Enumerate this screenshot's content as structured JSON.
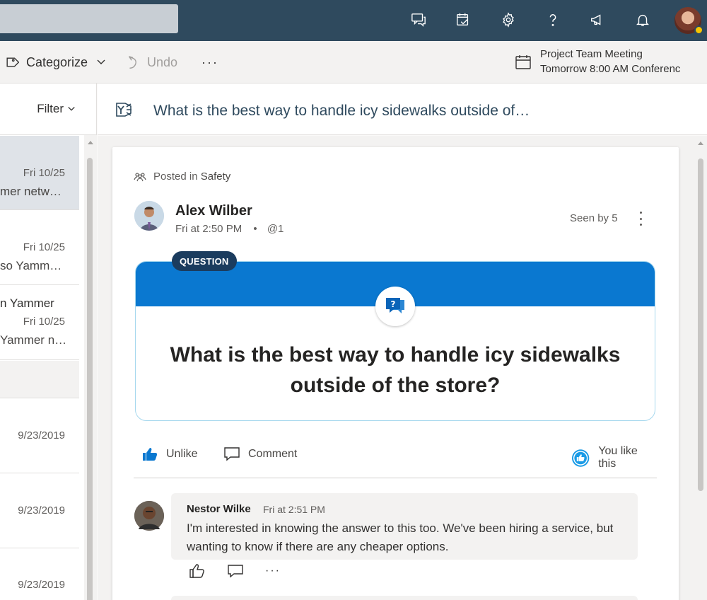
{
  "header": {
    "icons": [
      "chat-icon",
      "tasks-icon",
      "gear-icon",
      "help-icon",
      "megaphone-icon",
      "bell-icon"
    ]
  },
  "toolbar": {
    "categorize_label": "Categorize",
    "undo_label": "Undo",
    "more_label": "···",
    "meeting_title": "Project Team Meeting",
    "meeting_detail": "Tomorrow 8:00 AM Conferenc"
  },
  "message_list": {
    "filter_label": "Filter",
    "items": [
      {
        "date": "Fri 10/25",
        "preview": "mer netw…"
      },
      {
        "date": "Fri 10/25",
        "preview": "so Yamm…"
      },
      {
        "sender": "n Yammer",
        "date": "Fri 10/25",
        "preview": "Yammer n…"
      },
      {
        "date": "9/23/2019"
      },
      {
        "date": "9/23/2019"
      },
      {
        "date": "9/23/2019"
      }
    ]
  },
  "reading": {
    "subject": "What is the best way to handle icy sidewalks outside of…",
    "posted_prefix": "Posted in ",
    "group": "Safety",
    "author": "Alex Wilber",
    "timestamp": "Fri at 2:50 PM",
    "bullet": "•",
    "mention": "@1",
    "seen_by": "Seen by 5",
    "badge": "QUESTION",
    "question": "What is the best way to handle icy sidewalks outside of the store?",
    "unlike_label": "Unlike",
    "comment_label": "Comment",
    "you_like": "You like this",
    "comment": {
      "author": "Nestor Wilke",
      "time": "Fri at 2:51 PM",
      "text": "I'm interested in knowing the answer to this too. We've been hiring a service, but wanting to know if there are any cheaper options.",
      "more_label": "···"
    }
  },
  "colors": {
    "topbar": "#2f4a5e",
    "accent": "#0a78d0",
    "badge": "#1b3c5e"
  }
}
